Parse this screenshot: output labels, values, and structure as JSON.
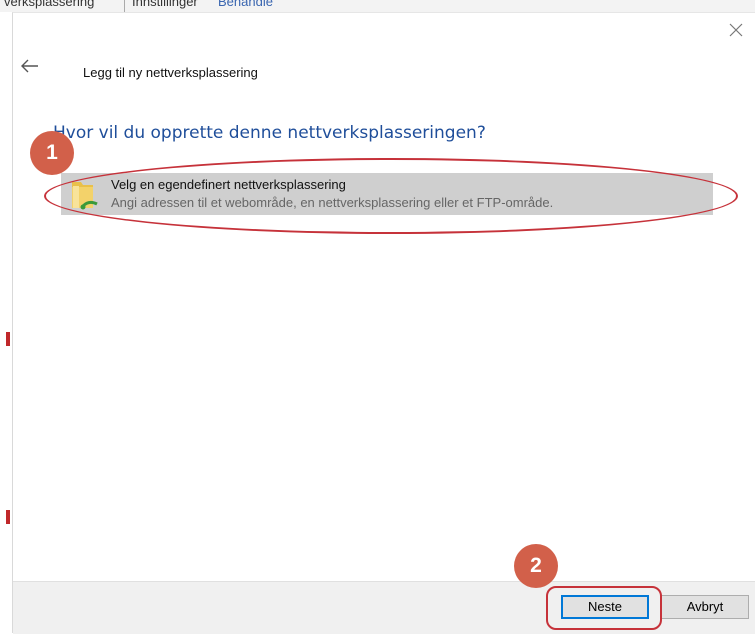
{
  "background_window": {
    "breadcrumb_text": "verksplassering",
    "menu_settings": "Innstillinger",
    "menu_manage": "Behandle"
  },
  "dialog": {
    "title": "Legg til ny nettverksplassering",
    "heading": "Hvor vil du opprette denne nettverksplasseringen?",
    "option": {
      "title": "Velg en egendefinert nettverksplassering",
      "description": "Angi adressen til et webområde, en nettverksplassering eller et FTP-område.",
      "icon": "folder-network-icon"
    },
    "buttons": {
      "next": "Neste",
      "cancel": "Avbryt"
    }
  },
  "annotations": {
    "badge_1": "1",
    "badge_2": "2",
    "color": "#c6323a",
    "badge_color": "#d2604a"
  }
}
